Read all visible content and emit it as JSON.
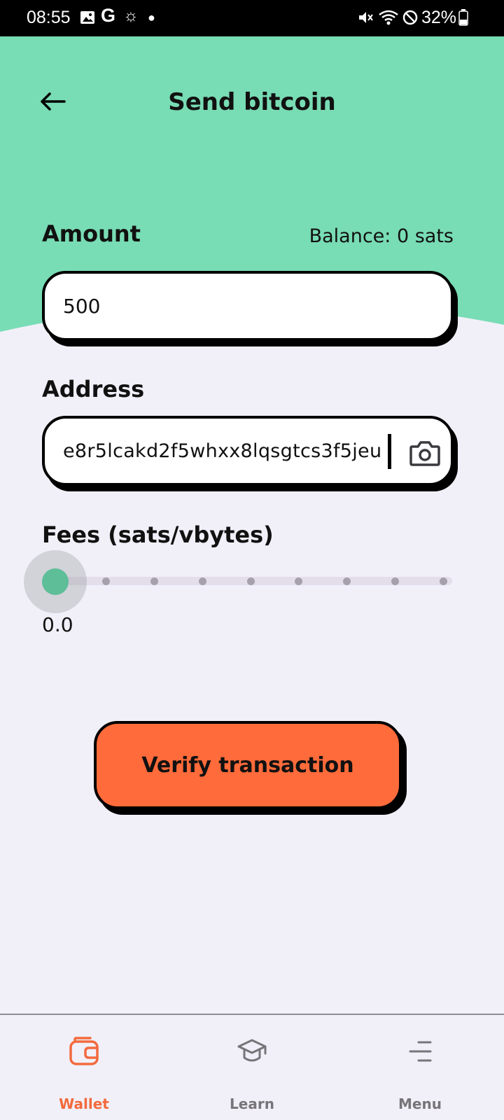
{
  "status_bar": {
    "time": "08:55",
    "g_label": "G",
    "battery": "32%"
  },
  "header": {
    "title": "Send bitcoin",
    "background_color": "#78DCB4"
  },
  "amount": {
    "label": "Amount",
    "balance": "Balance: 0 sats",
    "value": "500"
  },
  "address": {
    "label": "Address",
    "value": "e8r5lcakd2f5whxx8lqsgtcs3f5jeu"
  },
  "fees": {
    "label": "Fees (sats/vbytes)",
    "value": "0.0",
    "slider_position": 0,
    "tick_count": 9
  },
  "actions": {
    "verify_label": "Verify transaction",
    "verify_color": "#FF6B3A"
  },
  "bottom_nav": {
    "items": [
      {
        "label": "Wallet",
        "icon": "wallet-icon",
        "active": true
      },
      {
        "label": "Learn",
        "icon": "graduation-cap-icon",
        "active": false
      },
      {
        "label": "Menu",
        "icon": "menu-icon",
        "active": false
      }
    ],
    "active_color": "#F36A3D"
  }
}
